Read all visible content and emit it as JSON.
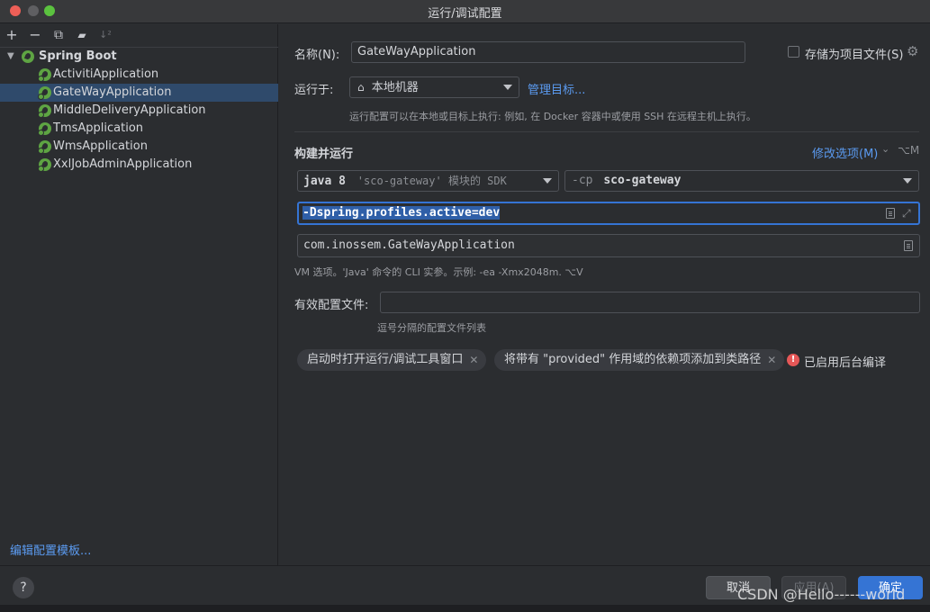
{
  "window": {
    "title": "运行/调试配置"
  },
  "toolbar": {
    "add": "+",
    "remove": "−",
    "copy": "⧉",
    "folder": "▰",
    "sort": "↓²"
  },
  "tree": {
    "root": {
      "label": "Spring Boot",
      "expanded": true
    },
    "items": [
      {
        "label": "ActivitiApplication"
      },
      {
        "label": "GateWayApplication",
        "selected": true
      },
      {
        "label": "MiddleDeliveryApplication"
      },
      {
        "label": "TmsApplication"
      },
      {
        "label": "WmsApplication"
      },
      {
        "label": "XxlJobAdminApplication"
      }
    ],
    "edit_templates": "编辑配置模板..."
  },
  "form": {
    "name_label": "名称(N):",
    "name_value": "GateWayApplication",
    "store_as_file": "存储为项目文件(S)",
    "run_on_label": "运行于:",
    "run_on_value": "本地机器",
    "manage_targets": "管理目标...",
    "run_on_hint": "运行配置可以在本地或目标上执行: 例如, 在 Docker 容器中或使用 SSH 在远程主机上执行。",
    "build_run_title": "构建并运行",
    "modify_options": "修改选项(M)",
    "modify_shortcut": "⌥M",
    "sdk_java": "java 8",
    "sdk_rest": "'sco-gateway' 模块的 SDK",
    "cp_flag": "-cp",
    "cp_value": "sco-gateway",
    "vm_options": "-Dspring.profiles.active=dev",
    "main_class": "com.inossem.GateWayApplication",
    "vm_hint": "VM 选项。'Java' 命令的 CLI 实参。示例: -ea -Xmx2048m. ⌥V",
    "profiles_label": "有效配置文件:",
    "profiles_value": "",
    "profiles_hint": "逗号分隔的配置文件列表",
    "chips": [
      "启动时打开运行/调试工具窗口",
      "将带有 \"provided\" 作用域的依赖项添加到类路径"
    ],
    "warning_text": "已启用后台编译"
  },
  "buttons": {
    "help": "?",
    "cancel": "取消",
    "apply": "应用(A)",
    "ok": "确定"
  },
  "watermark": "CSDN @Hello------world",
  "colors": {
    "accent": "#3574d4",
    "link": "#5b9bf1",
    "spring": "#5ea443",
    "selection": "#2f4a6b"
  }
}
